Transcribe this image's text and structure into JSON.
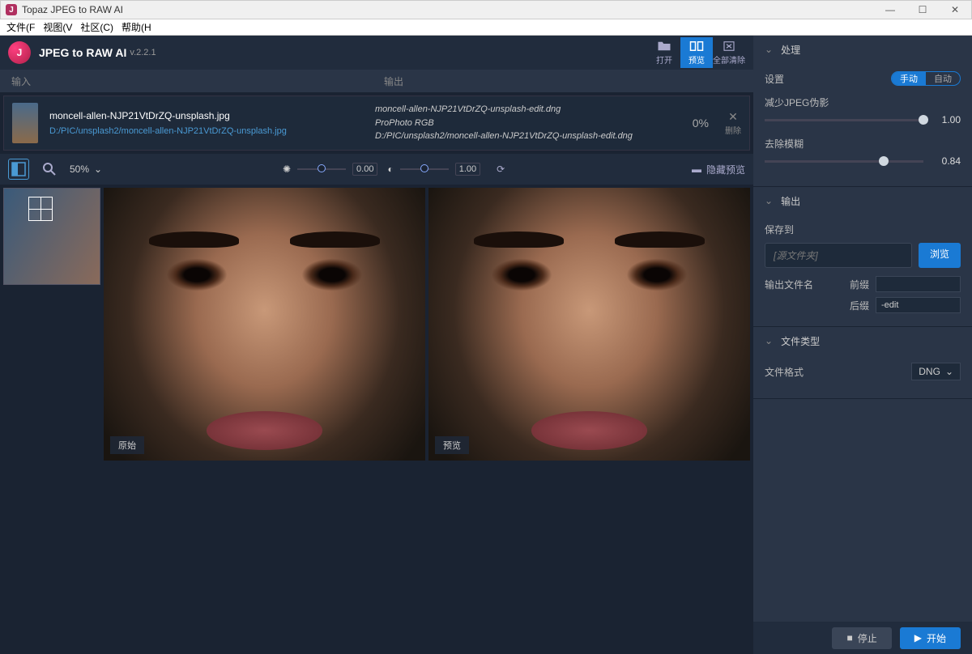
{
  "window": {
    "title": "Topaz JPEG to RAW AI"
  },
  "menu": {
    "file": "文件(F",
    "view": "视图(V",
    "community": "社区(C)",
    "help": "帮助(H"
  },
  "header": {
    "app_name": "JPEG to RAW AI",
    "version": "v.2.2.1",
    "open": "打开",
    "preview": "预览",
    "clear_all": "全部清除"
  },
  "list": {
    "input_col": "输入",
    "output_col": "输出",
    "row": {
      "name": "moncell-allen-NJP21VtDrZQ-unsplash.jpg",
      "path": "D:/PIC/unsplash2/moncell-allen-NJP21VtDrZQ-unsplash.jpg",
      "out_name": "moncell-allen-NJP21VtDrZQ-unsplash-edit.dng",
      "colorspace": "ProPhoto RGB",
      "out_path": "D:/PIC/unsplash2/moncell-allen-NJP21VtDrZQ-unsplash-edit.dng",
      "progress": "0%",
      "delete": "删除"
    }
  },
  "preview_bar": {
    "zoom": "50%",
    "brightness_val": "0.00",
    "gamma_val": "1.00",
    "hide_preview": "隐藏预览"
  },
  "preview": {
    "original": "原始",
    "preview": "预览"
  },
  "panel": {
    "processing": "处理",
    "settings": "设置",
    "manual": "手动",
    "auto": "自动",
    "reduce_artifacts": "减少JPEG伪影",
    "reduce_val": "1.00",
    "deblur": "去除模糊",
    "deblur_val": "0.84",
    "output": "输出",
    "save_to": "保存到",
    "source_folder": "[源文件夹]",
    "browse": "浏览",
    "output_filename": "输出文件名",
    "prefix": "前缀",
    "suffix": "后缀",
    "suffix_val": "-edit",
    "file_type": "文件类型",
    "file_format": "文件格式",
    "format_val": "DNG"
  },
  "bottom": {
    "stop": "停止",
    "start": "开始"
  }
}
